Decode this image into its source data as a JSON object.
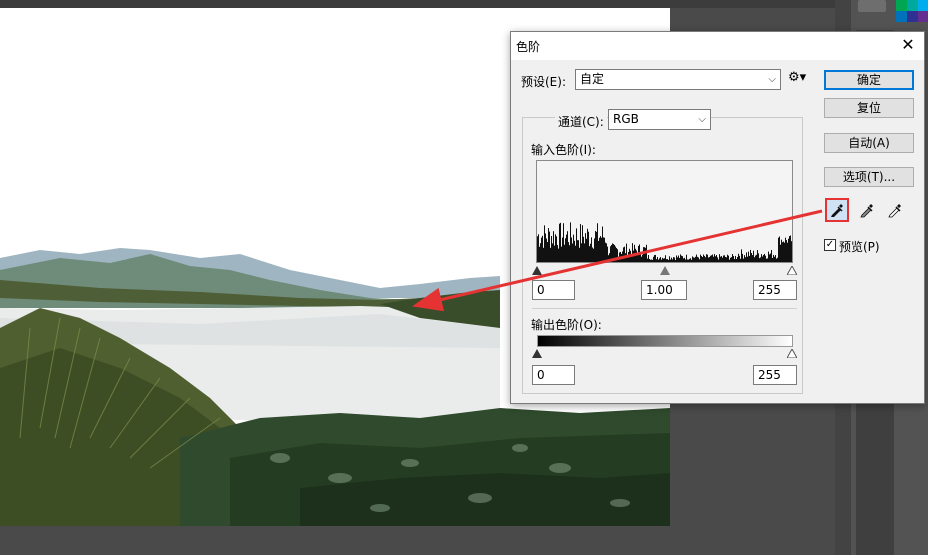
{
  "dialog": {
    "title": "色阶",
    "close": "✕",
    "preset_label": "预设(E):",
    "preset_value": "自定",
    "channel_label": "通道(C):",
    "channel_value": "RGB",
    "input_levels_label": "输入色阶(I):",
    "input_black": "0",
    "input_gamma": "1.00",
    "input_white": "255",
    "output_levels_label": "输出色阶(O):",
    "output_black": "0",
    "output_white": "255",
    "buttons": {
      "ok": "确定",
      "reset": "复位",
      "auto": "自动(A)",
      "options": "选项(T)..."
    },
    "preview_label": "预览(P)",
    "preview_checked": "✓"
  },
  "colors": {
    "highlight": "#e53333",
    "accent": "#0078d7"
  },
  "icons": [
    "close-icon",
    "gear-icon",
    "eyedropper-black-icon",
    "eyedropper-gray-icon",
    "eyedropper-white-icon",
    "chevron-down-icon"
  ]
}
